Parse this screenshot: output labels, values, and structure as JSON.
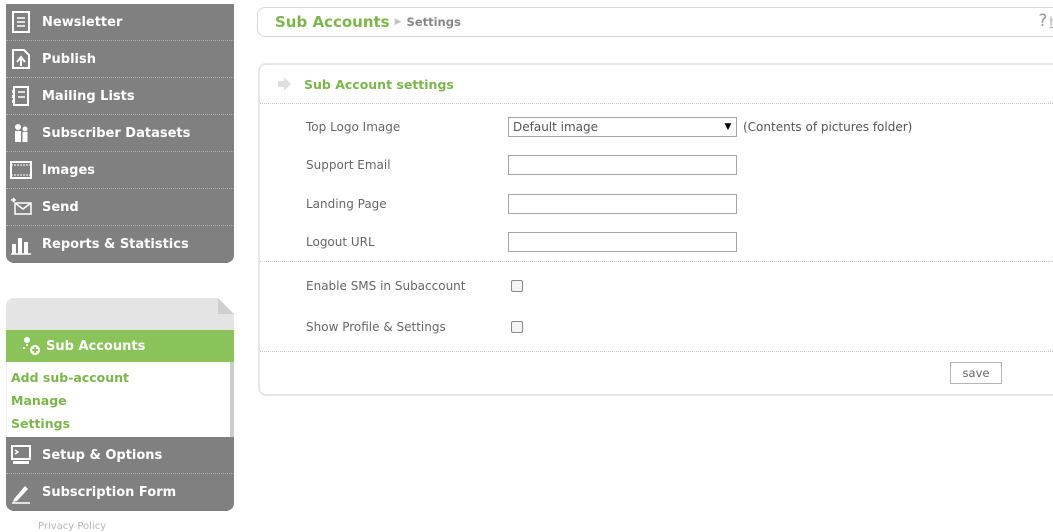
{
  "sidebar": {
    "items": [
      {
        "label": "Newsletter",
        "icon": "newsletter-icon"
      },
      {
        "label": "Publish",
        "icon": "publish-icon"
      },
      {
        "label": "Mailing Lists",
        "icon": "mailing-lists-icon"
      },
      {
        "label": "Subscriber Datasets",
        "icon": "subscribers-icon"
      },
      {
        "label": "Images",
        "icon": "images-icon"
      },
      {
        "label": "Send",
        "icon": "send-icon"
      },
      {
        "label": "Reports & Statistics",
        "icon": "reports-icon"
      }
    ],
    "sub_accounts": {
      "title": "Sub Accounts",
      "links": [
        "Add sub-account",
        "Manage",
        "Settings"
      ]
    },
    "bottom_items": [
      {
        "label": "Setup & Options",
        "icon": "setup-icon"
      },
      {
        "label": "Subscription Form",
        "icon": "subscription-form-icon"
      }
    ],
    "privacy": "Privacy Policy"
  },
  "breadcrumb": {
    "section": "Sub Accounts",
    "current": "Settings",
    "help": "?",
    "help_link": "h"
  },
  "panel": {
    "title": "Sub Account settings",
    "fields": {
      "top_logo_label": "Top Logo Image",
      "top_logo_value": "Default image",
      "top_logo_hint": "(Contents of pictures folder)",
      "support_email_label": "Support Email",
      "support_email_value": "",
      "landing_page_label": "Landing Page",
      "landing_page_value": "",
      "logout_url_label": "Logout URL",
      "logout_url_value": "",
      "enable_sms_label": "Enable SMS in Subaccount",
      "enable_sms_checked": false,
      "show_profile_label": "Show Profile & Settings",
      "show_profile_checked": false
    },
    "save_label": "save"
  },
  "colors": {
    "accent_green": "#7cb64a",
    "sidebar_gray": "#808080",
    "sub_header_green": "#89c35a"
  }
}
